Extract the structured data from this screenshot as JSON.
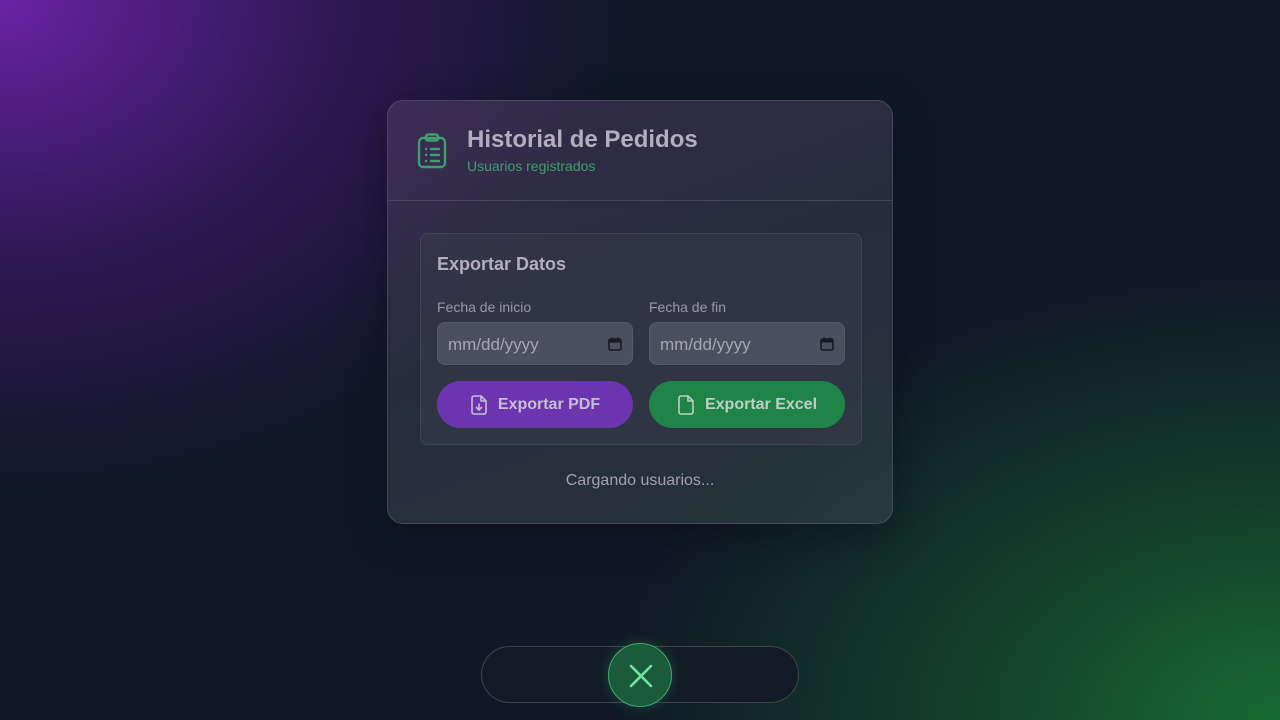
{
  "header": {
    "title": "Historial de Pedidos",
    "subtitle": "Usuarios registrados",
    "icon": "clipboard-list-icon"
  },
  "export": {
    "title": "Exportar Datos",
    "start_label": "Fecha de inicio",
    "end_label": "Fecha de fin",
    "start_value": "mm/dd/yyyy",
    "end_value": "mm/dd/yyyy",
    "pdf_label": "Exportar PDF",
    "excel_label": "Exportar Excel"
  },
  "status": {
    "loading": "Cargando usuarios..."
  },
  "bottom_bar": {
    "close_icon": "close-icon"
  },
  "colors": {
    "accent_green": "#3f9e6a",
    "pdf_button": "#6d34b0",
    "excel_button": "#1e8447"
  }
}
